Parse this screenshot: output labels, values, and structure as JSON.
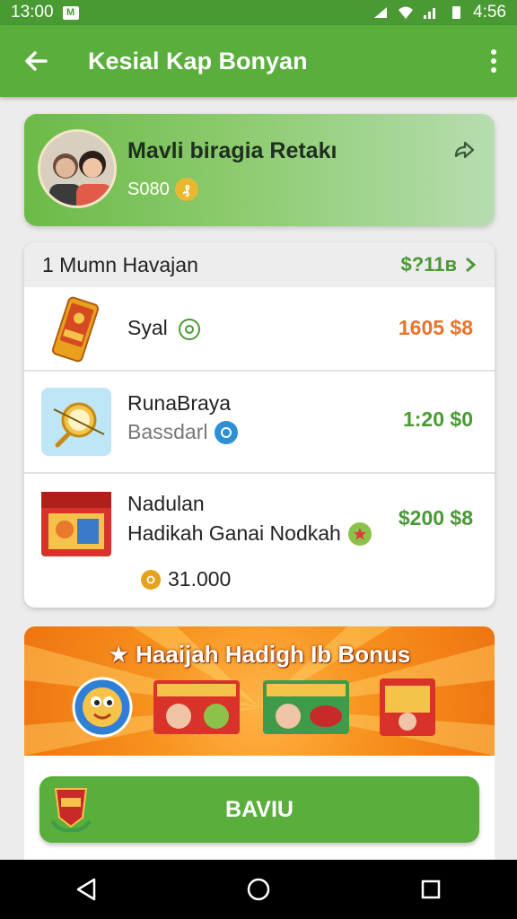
{
  "status_bar": {
    "time": "13:00",
    "app_badge": "M",
    "right_time": "4:56"
  },
  "app_bar": {
    "title": "Kesial Kap Bonyan"
  },
  "profile": {
    "name": "Mavli biragia Retakı",
    "sub": "S080",
    "coin_symbol": "₰"
  },
  "list": {
    "header_title": "1 Mumn Havajan",
    "header_value": "$?11ʙ",
    "items": [
      {
        "name": "Syal",
        "price": "1605 $8",
        "price_color": "#e8742a"
      },
      {
        "name": "RunaBraya",
        "sub": "Bassdarl",
        "price": "1:20 $0",
        "price_color": "#4a9a34"
      },
      {
        "name": "Nadulan",
        "sub": "Hadikah Ganai Nodkah",
        "price": "$200 $8",
        "price_color": "#4a9a34",
        "coins": "31.000"
      }
    ]
  },
  "bonus": {
    "title": "★ Haaijah Hadigh Ib Bonus",
    "button_label": "BAVIU"
  },
  "colors": {
    "primary_green": "#5aae3b",
    "status_green": "#4a9a34",
    "orange": "#f7921e"
  }
}
